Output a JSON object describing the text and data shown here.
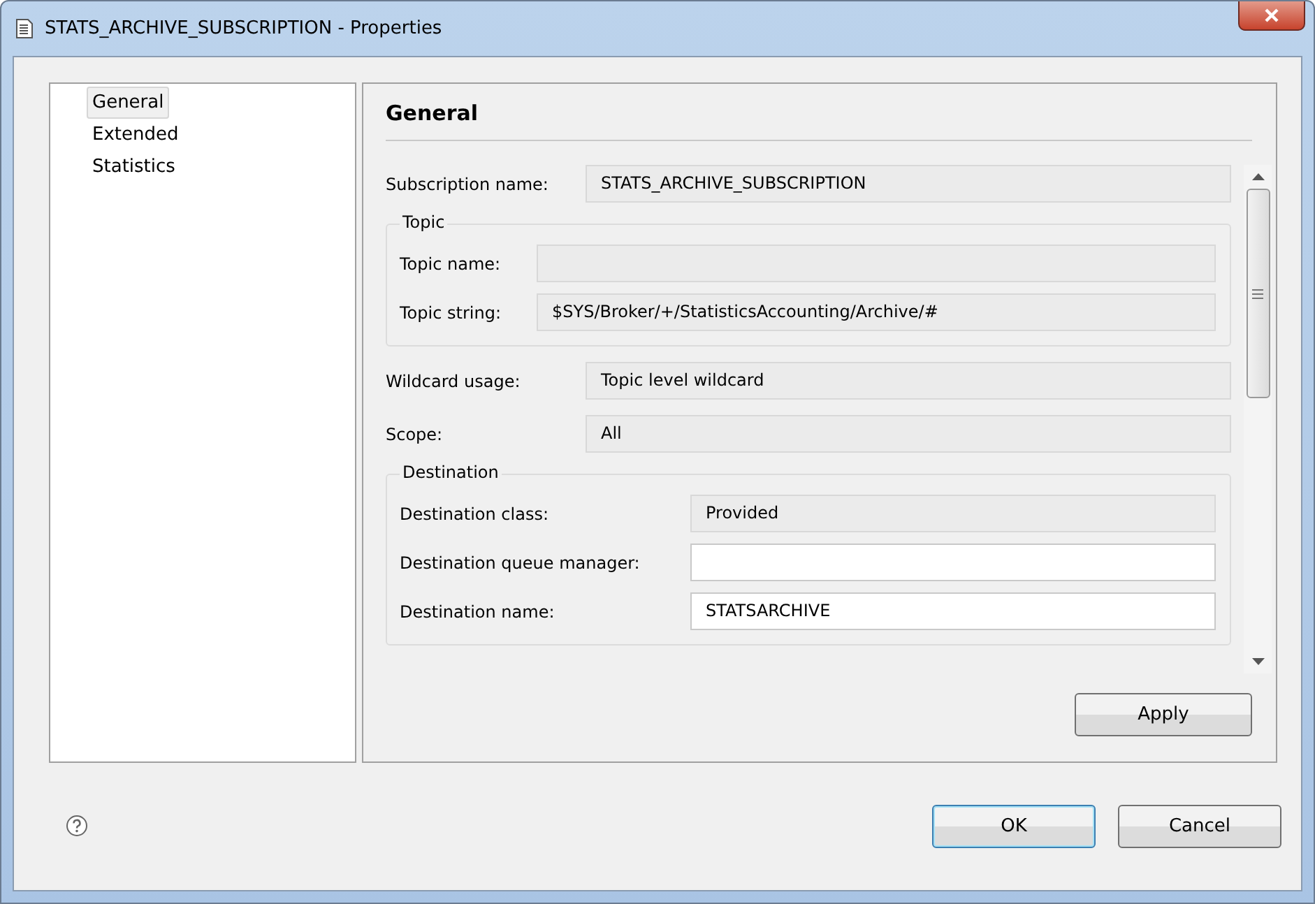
{
  "window": {
    "title": "STATS_ARCHIVE_SUBSCRIPTION - Properties"
  },
  "sidebar": {
    "items": [
      {
        "label": "General",
        "selected": true
      },
      {
        "label": "Extended",
        "selected": false
      },
      {
        "label": "Statistics",
        "selected": false
      }
    ]
  },
  "page": {
    "title": "General",
    "items": [
      {
        "kind": "field",
        "label": "Subscription name:",
        "value": "STATS_ARCHIVE_SUBSCRIPTION",
        "editable": false
      },
      {
        "kind": "group",
        "title": "Topic",
        "fields": [
          {
            "label": "Topic name:",
            "editable": false
          },
          {
            "label": "Topic string:",
            "value": "$SYS/Broker/+/StatisticsAccounting/Archive/#",
            "editable": false
          }
        ]
      },
      {
        "kind": "field",
        "label": "Wildcard usage:",
        "value": "Topic level wildcard",
        "editable": false
      },
      {
        "kind": "field",
        "label": "Scope:",
        "value": "All",
        "editable": false
      },
      {
        "kind": "group",
        "title": "Destination",
        "fields": [
          {
            "label": "Destination class:",
            "value": "Provided",
            "editable": false
          },
          {
            "label": "Destination queue manager:",
            "editable": true
          },
          {
            "label": "Destination name:",
            "value": "STATSARCHIVE",
            "editable": true
          }
        ]
      }
    ],
    "apply": "Apply"
  },
  "buttons": [
    {
      "label": "OK",
      "default": true
    },
    {
      "label": "Cancel",
      "default": false
    }
  ]
}
